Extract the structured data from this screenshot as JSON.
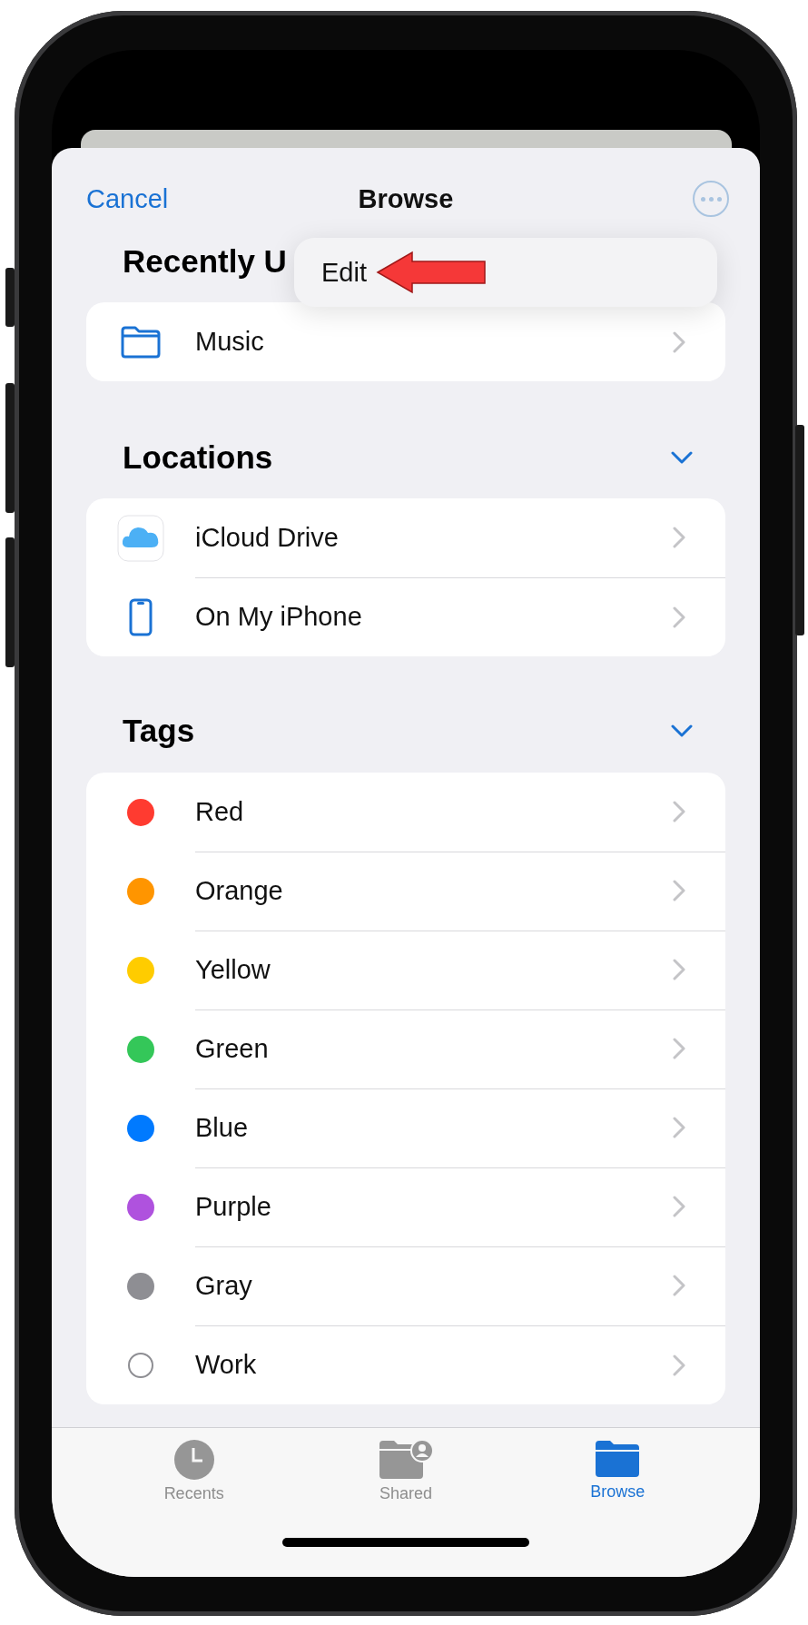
{
  "nav": {
    "cancel": "Cancel",
    "title": "Browse"
  },
  "menu": {
    "items": [
      {
        "label": "Edit"
      }
    ]
  },
  "recent": {
    "title": "Recently U",
    "items": [
      {
        "label": "Music",
        "kind": "folder"
      }
    ]
  },
  "locations": {
    "title": "Locations",
    "expanded": true,
    "items": [
      {
        "label": "iCloud Drive",
        "kind": "cloud"
      },
      {
        "label": "On My iPhone",
        "kind": "phone"
      }
    ]
  },
  "tags": {
    "title": "Tags",
    "expanded": true,
    "items": [
      {
        "label": "Red",
        "kind": "dot",
        "color": "#ff3b30"
      },
      {
        "label": "Orange",
        "kind": "dot",
        "color": "#ff9500"
      },
      {
        "label": "Yellow",
        "kind": "dot",
        "color": "#ffcc00"
      },
      {
        "label": "Green",
        "kind": "dot",
        "color": "#34c759"
      },
      {
        "label": "Blue",
        "kind": "dot",
        "color": "#007aff"
      },
      {
        "label": "Purple",
        "kind": "dot",
        "color": "#af52de"
      },
      {
        "label": "Gray",
        "kind": "dot",
        "color": "#8e8e93"
      },
      {
        "label": "Work",
        "kind": "empty"
      }
    ]
  },
  "tab_bar": [
    {
      "label": "Recents",
      "kind": "clock",
      "selected": false
    },
    {
      "label": "Shared",
      "kind": "shared",
      "selected": false
    },
    {
      "label": "Browse",
      "kind": "folder",
      "selected": true
    }
  ]
}
